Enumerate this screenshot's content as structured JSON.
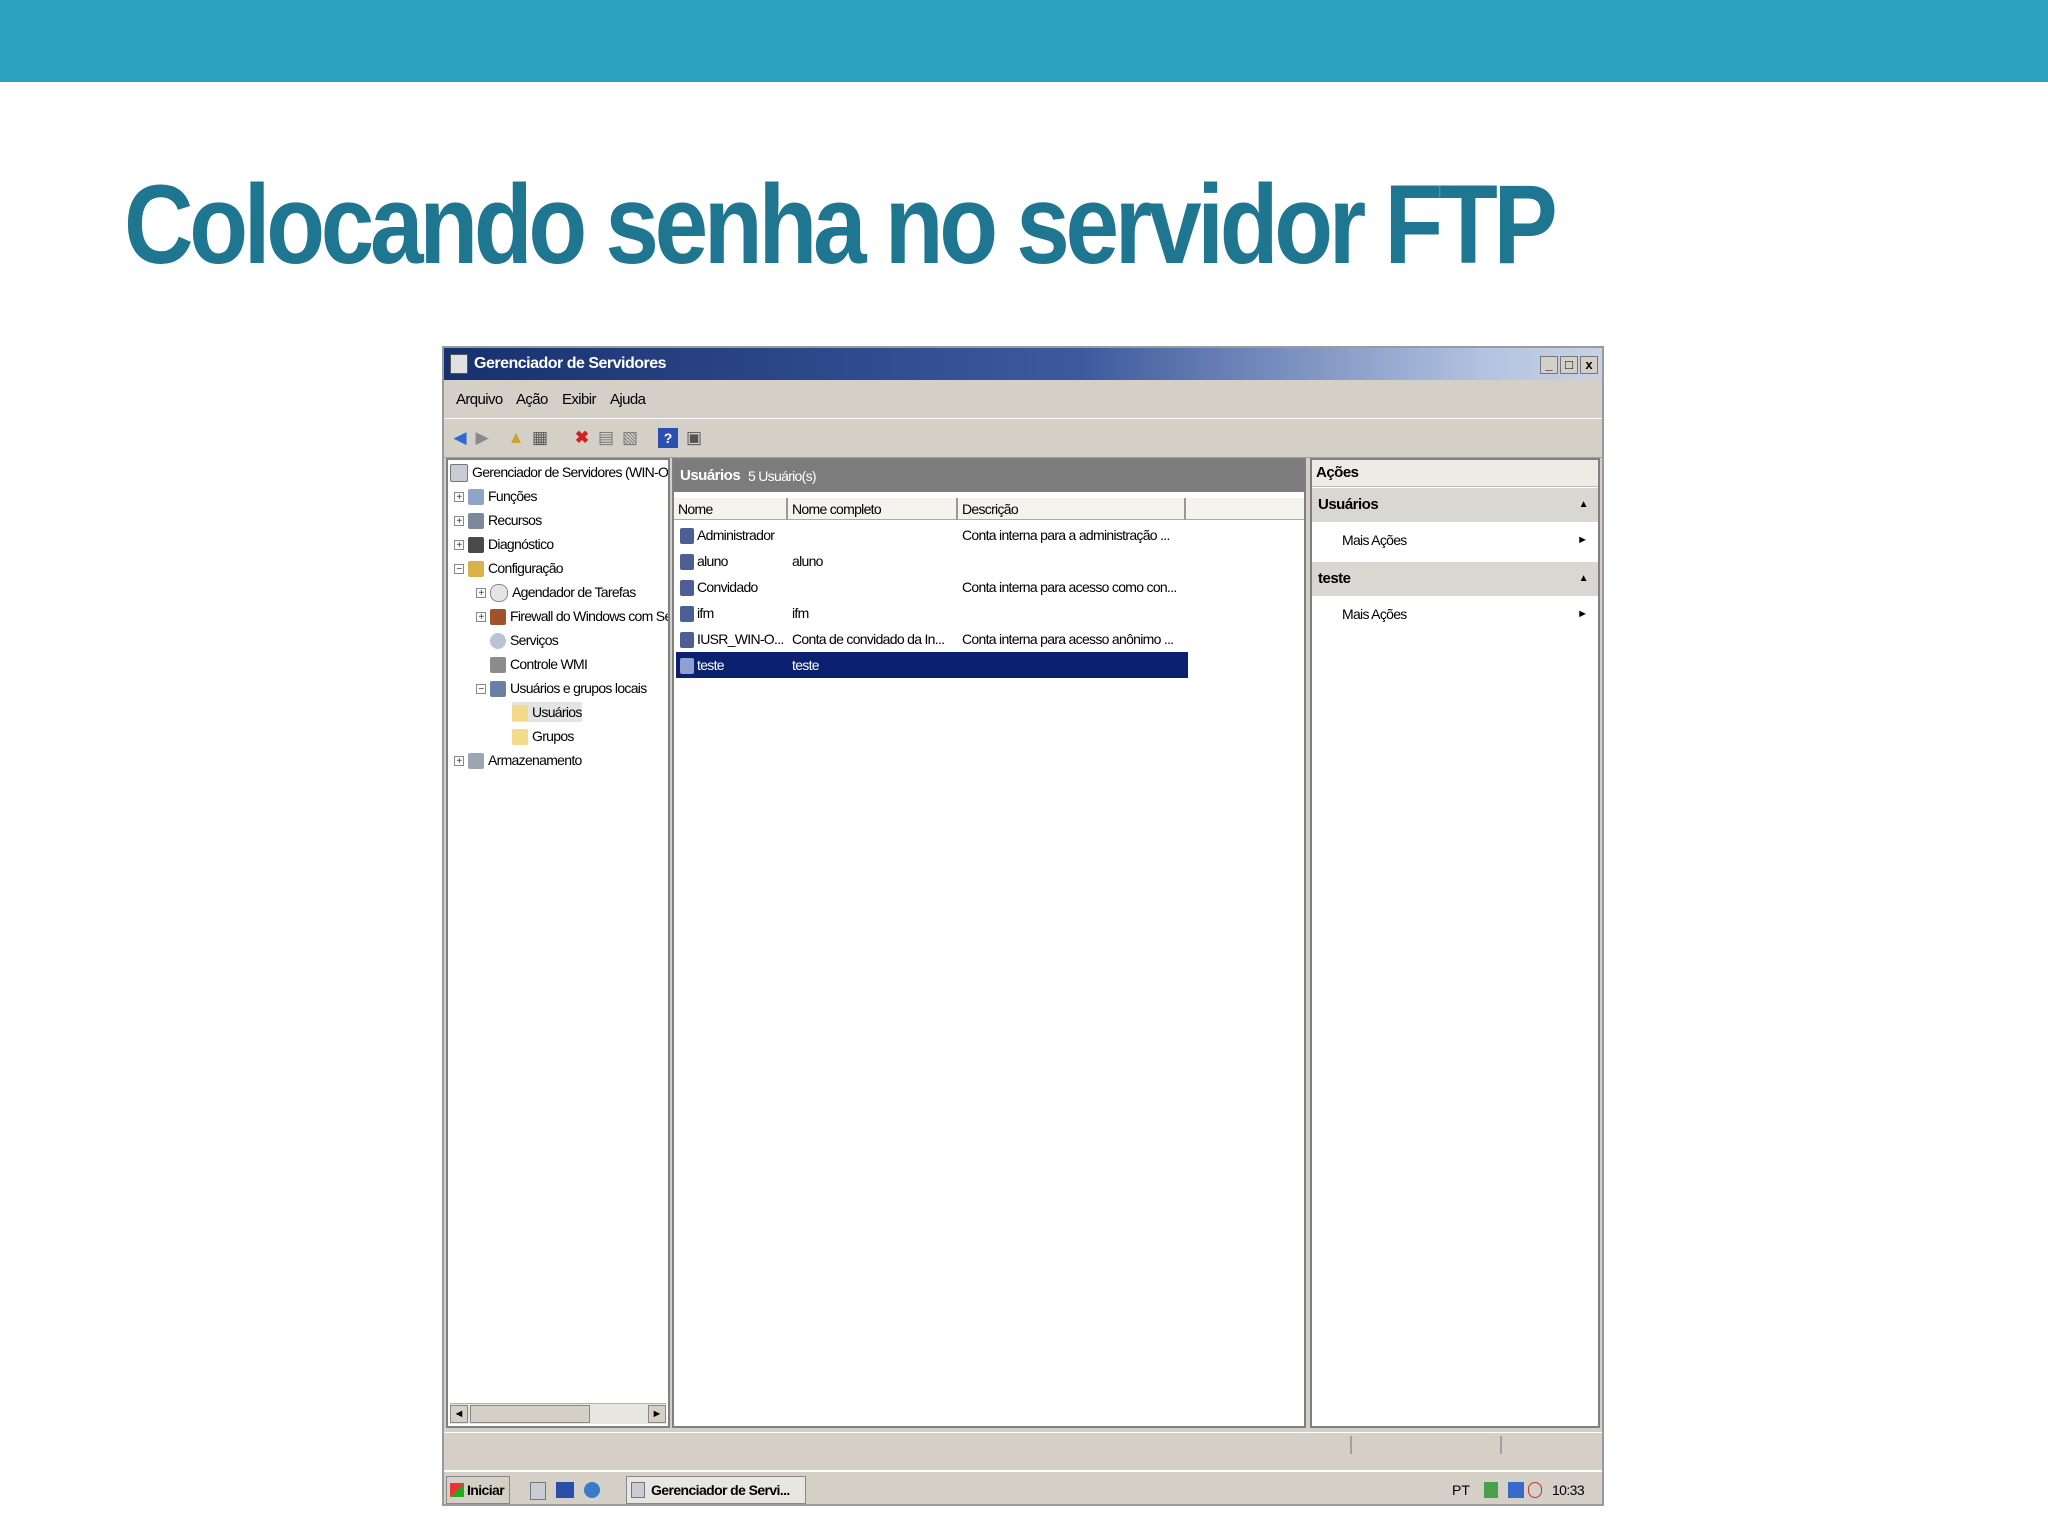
{
  "slide": {
    "title": "Colocando senha no servidor FTP"
  },
  "window": {
    "title": "Gerenciador de Servidores",
    "buttons": {
      "minimize": "_",
      "maximize": "□",
      "close": "x"
    }
  },
  "menu": [
    "Arquivo",
    "Ação",
    "Exibir",
    "Ajuda"
  ],
  "tree": [
    {
      "label": "Gerenciador de Servidores (WIN-OI",
      "expander": ""
    },
    {
      "label": "Funções",
      "expander": "+"
    },
    {
      "label": "Recursos",
      "expander": "+"
    },
    {
      "label": "Diagnóstico",
      "expander": "+"
    },
    {
      "label": "Configuração",
      "expander": "−"
    },
    {
      "label": "Agendador de Tarefas",
      "expander": "+"
    },
    {
      "label": "Firewall do Windows com Se",
      "expander": "+"
    },
    {
      "label": "Serviços",
      "expander": ""
    },
    {
      "label": "Controle WMI",
      "expander": ""
    },
    {
      "label": "Usuários e grupos locais",
      "expander": "−"
    },
    {
      "label": "Usuários",
      "expander": ""
    },
    {
      "label": "Grupos",
      "expander": ""
    },
    {
      "label": "Armazenamento",
      "expander": "+"
    }
  ],
  "scroll": {
    "left": "◄",
    "right": "►"
  },
  "users_panel": {
    "title": "Usuários",
    "count": "5 Usuário(s)",
    "columns": [
      "Nome",
      "Nome completo",
      "Descrição"
    ],
    "rows": [
      {
        "name": "Administrador",
        "full": "",
        "desc": "Conta interna para a administração ..."
      },
      {
        "name": "aluno",
        "full": "aluno",
        "desc": ""
      },
      {
        "name": "Convidado",
        "full": "",
        "desc": "Conta interna para acesso como con..."
      },
      {
        "name": "ifm",
        "full": "ifm",
        "desc": ""
      },
      {
        "name": "IUSR_WIN-O...",
        "full": "Conta de convidado da In...",
        "desc": "Conta interna para acesso anônimo ..."
      },
      {
        "name": "teste",
        "full": "teste",
        "desc": ""
      }
    ],
    "selected_row": 5
  },
  "actions_panel": {
    "title": "Ações",
    "sections": [
      {
        "title": "Usuários",
        "arrow": "▲",
        "link": "Mais Ações",
        "link_arrow": "►"
      },
      {
        "title": "teste",
        "arrow": "▲",
        "link": "Mais Ações",
        "link_arrow": "►"
      }
    ]
  },
  "taskbar": {
    "start": "Iniciar",
    "task": "Gerenciador de Servi...",
    "lang": "PT",
    "clock": "10:33"
  },
  "colors": {
    "accent": "#2ba3c0",
    "title": "#1f7691",
    "selection": "#0b2170"
  }
}
